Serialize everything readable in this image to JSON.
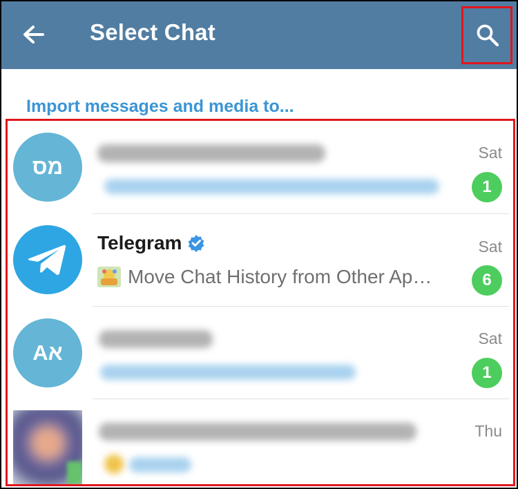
{
  "header": {
    "title": "Select Chat",
    "colors": {
      "bar": "#517da2",
      "highlight": "#e0161d"
    }
  },
  "import_label": "Import messages and media to...",
  "chats": [
    {
      "avatar_text": "מס",
      "avatar_color": "#64b5d6",
      "time": "Sat",
      "unread": "1"
    },
    {
      "name": "Telegram",
      "preview": "Move Chat History from Other Ap…",
      "time": "Sat",
      "unread": "6",
      "avatar_icon": "telegram-plane-icon",
      "avatar_color": "#2ea6e3",
      "verified": true
    },
    {
      "avatar_text": "Aא",
      "avatar_color": "#64b5d6",
      "time": "Sat",
      "unread": "1"
    },
    {
      "time": "Thu",
      "avatar_icon": "photo-avatar"
    }
  ]
}
